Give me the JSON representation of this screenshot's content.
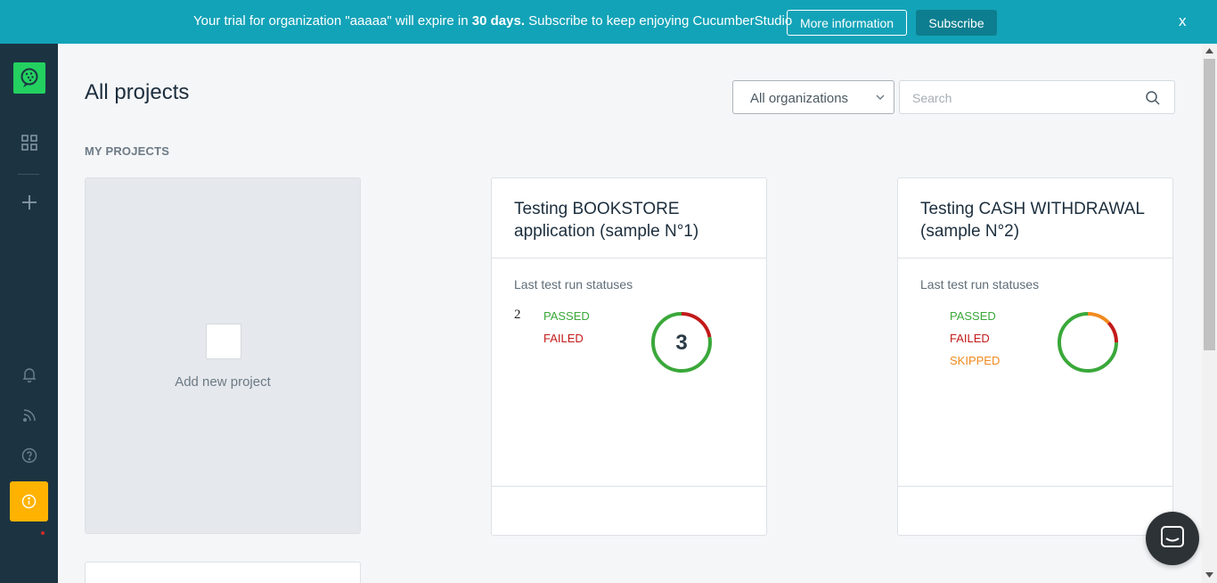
{
  "banner": {
    "message_before": "Your trial for organization \"aaaaa\" will expire in ",
    "message_bold": "30 days.",
    "message_after": " Subscribe to keep enjoying CucumberStudio",
    "more_info_label": "More information",
    "subscribe_label": "Subscribe",
    "close_label": "x"
  },
  "sidebar": {
    "icons": [
      "cucumber-logo-icon",
      "grid-icon",
      "plus-icon",
      "bell-icon",
      "rss-icon",
      "help-icon",
      "info-icon"
    ]
  },
  "main": {
    "title": "All projects",
    "section_label": "MY PROJECTS",
    "org_select": {
      "selected": "All organizations"
    },
    "search": {
      "placeholder": "Search"
    },
    "add_project_label": "Add new project",
    "projects": [
      {
        "title": "Testing BOOKSTORE application (sample N°1)",
        "subtitle": "Last test run statuses",
        "count": "2",
        "statuses": [
          "PASSED",
          "FAILED"
        ],
        "center_value": "3",
        "passed_fraction": 0.78,
        "failed_fraction": 0.22
      },
      {
        "title": "Testing CASH WITHDRAWAL (sample N°2)",
        "subtitle": "Last test run statuses",
        "statuses": [
          "PASSED",
          "FAILED",
          "SKIPPED"
        ],
        "passed_fraction": 0.75,
        "skipped_fraction": 0.13,
        "failed_fraction": 0.12
      }
    ]
  },
  "colors": {
    "banner": "#13a3b8",
    "sidebar": "#1c3442",
    "passed": "#3aa83a",
    "failed": "#c21a1a",
    "skipped": "#f08a1e",
    "info_button": "#ffb300",
    "logo": "#23d160"
  }
}
